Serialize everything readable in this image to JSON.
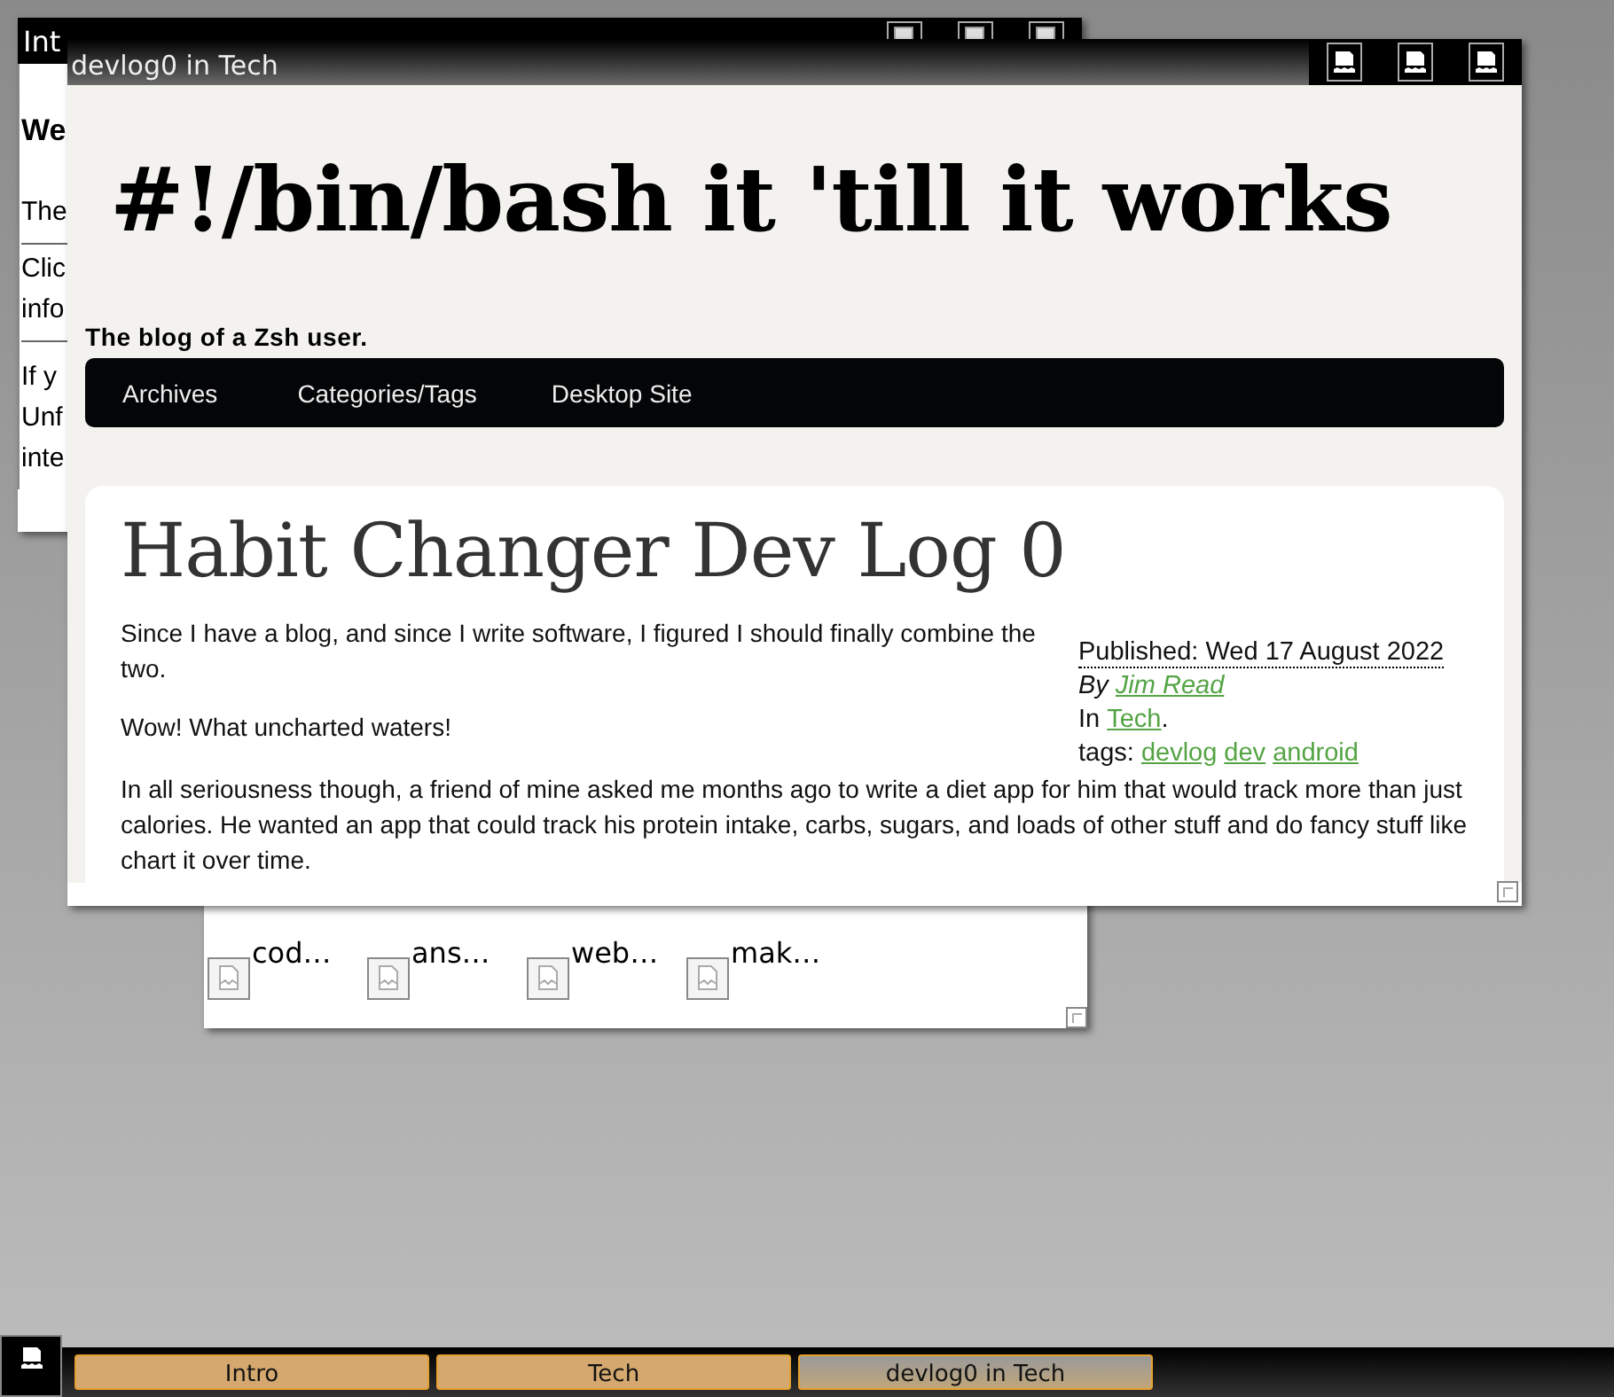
{
  "intro_window": {
    "title": "Int",
    "heading": "We",
    "paragraphs": [
      [
        "The"
      ],
      [
        "Clic",
        "info"
      ],
      [
        "If y",
        "Unf",
        "inte"
      ]
    ]
  },
  "tech_window": {
    "items": [
      {
        "label": "cod…"
      },
      {
        "label": "ans…"
      },
      {
        "label": "web…"
      },
      {
        "label": "mak…"
      }
    ]
  },
  "devlog_window": {
    "title": "devlog0 in Tech",
    "blog": {
      "title": "#!/bin/bash it 'till it works",
      "tagline": "The blog of a Zsh user.",
      "nav": [
        "Archives",
        "Categories/Tags",
        "Desktop Site"
      ],
      "post": {
        "title": "Habit Changer Dev Log 0",
        "paragraphs": [
          "Since I have a blog, and since I write software, I figured I should finally combine the two.",
          "Wow! What uncharted waters!",
          "In all seriousness though, a friend of mine asked me months ago to write a diet app for him that would track more than just calories. He wanted an app that could track his protein intake, carbs, sugars, and loads of other stuff and do fancy stuff like chart it over time."
        ],
        "meta": {
          "published": "Published: Wed 17 August 2022",
          "by_label": "By",
          "author": "Jim Read",
          "in_label": "In",
          "category": "Tech",
          "category_suffix": ".",
          "tags_label": "tags:",
          "tags": [
            "devlog",
            "dev",
            "android"
          ]
        }
      }
    }
  },
  "taskbar": {
    "tasks": [
      {
        "label": "Intro",
        "selected": false
      },
      {
        "label": "Tech",
        "selected": false
      },
      {
        "label": "devlog0 in Tech",
        "selected": true
      }
    ]
  }
}
